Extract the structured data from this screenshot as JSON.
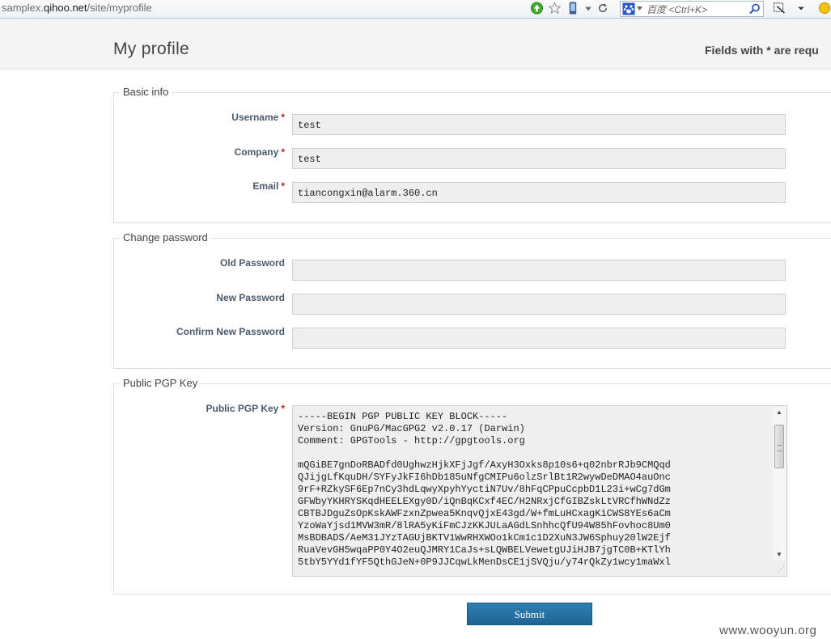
{
  "browser": {
    "url_gray": "samplex.",
    "url_domain": "qihoo.net",
    "url_path": "/site/myprofile",
    "search_placeholder": "百度 <Ctrl+K>"
  },
  "header": {
    "title": "My profile",
    "required_note": "Fields with * are requ"
  },
  "basic_info": {
    "legend": "Basic info",
    "fields": [
      {
        "label": "Username",
        "required": "*",
        "value": "test"
      },
      {
        "label": "Company",
        "required": "*",
        "value": "test"
      },
      {
        "label": "Email",
        "required": "*",
        "value": "tiancongxin@alarm.360.cn"
      }
    ]
  },
  "change_password": {
    "legend": "Change password",
    "fields": [
      {
        "label": "Old Password",
        "value": ""
      },
      {
        "label": "New Password",
        "value": ""
      },
      {
        "label": "Confirm New Password",
        "value": ""
      }
    ]
  },
  "pgp": {
    "legend": "Public PGP Key",
    "label": "Public PGP Key",
    "required": "*",
    "value": "-----BEGIN PGP PUBLIC KEY BLOCK-----\nVersion: GnuPG/MacGPG2 v2.0.17 (Darwin)\nComment: GPGTools - http://gpgtools.org\n\nmQGiBE7gnDoRBADfd0UghwzHjkXFjJgf/AxyH3Oxks8p10s6+q02nbrRJb9CMQqd\nQJijgLfKquDH/SYFyJkFI6hDb185uNfgCMIPu6olzSrlBt1R2wywDeDMAO4auOnc\n9rF+RZkySF6Ep7nCy3hdLqwyXpyhYyctiN7Uv/8hFqCPpuCcpbD1L23i+wCg7dGm\nGFWbyYKHRYSKqdHEELEXgy0D/iQnBqKCxf4EC/H2NRxjCfGIBZskLtVRCfhWNdZz\nCBTBJDguZsOpKskAWFzxnZpwea5KnqvQjxE43gd/W+fmLuHCxagKiCWS8YEs6aCm\nYzoWaYjsd1MVW3mR/8lRA5yKiFmCJzKKJULaAGdLSnhhcQfU94W85hFovhoc8Um0\nMsBDBADS/AeM31JYzTAGUjBKTV1WwRHXWOo1kCm1c1D2XuN3JW6Sphuy20lW2Ejf\nRuaVevGH5wqaPP0Y4O2euQJMRY1CaJs+sLQWBELVewetgUJiHJB7jgTC0B+KTlYh\n5tbY5YYd1fYF5QthGJeN+0P9JJCqwLkMenDsCE1jSVQju/y74rQkZy1wcy1maWxl"
  },
  "submit_label": "Submit",
  "watermark": "www.wooyun.org"
}
